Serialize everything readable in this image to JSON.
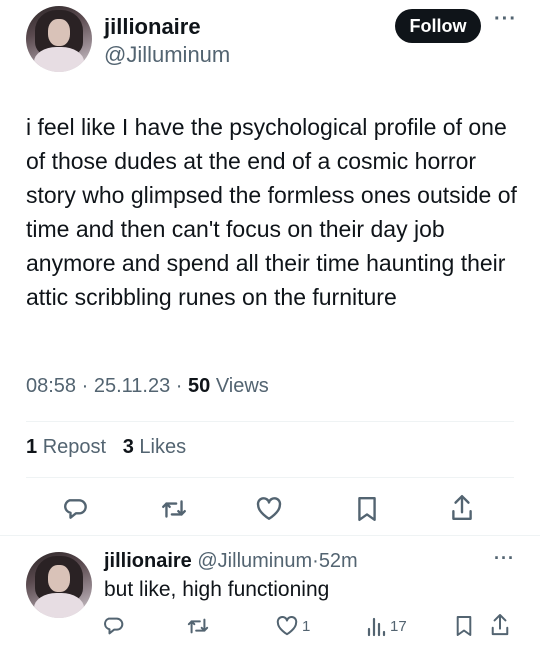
{
  "tweet": {
    "display_name": "jillionaire",
    "handle": "@Jilluminum",
    "follow_label": "Follow",
    "more_label": "···",
    "text": "i feel like I have the psychological profile of one of those dudes at the end of a cosmic horror story who glimpsed the formless ones outside of time and then can't focus on their day job anymore and spend all their time haunting their attic scribbling runes on the furniture",
    "time": "08:58",
    "date": "25.11.23",
    "views_count": "50",
    "views_label": "Views",
    "reposts_count": "1",
    "reposts_label": "Repost",
    "likes_count": "3",
    "likes_label": "Likes",
    "icons": [
      "reply-icon",
      "repost-icon",
      "like-icon",
      "bookmark-icon",
      "share-icon"
    ]
  },
  "reply": {
    "display_name": "jillionaire",
    "handle": "@Jilluminum",
    "age": "52m",
    "more_label": "···",
    "text": "but like, high functioning",
    "like_count": "1",
    "views_count": "17",
    "icons": [
      "reply-icon",
      "repost-icon",
      "like-icon",
      "views-icon",
      "bookmark-icon",
      "share-icon"
    ]
  },
  "colors": {
    "text": "#0f1419",
    "secondary": "#536471",
    "divider": "#eff3f4",
    "button": "#0f1419"
  }
}
